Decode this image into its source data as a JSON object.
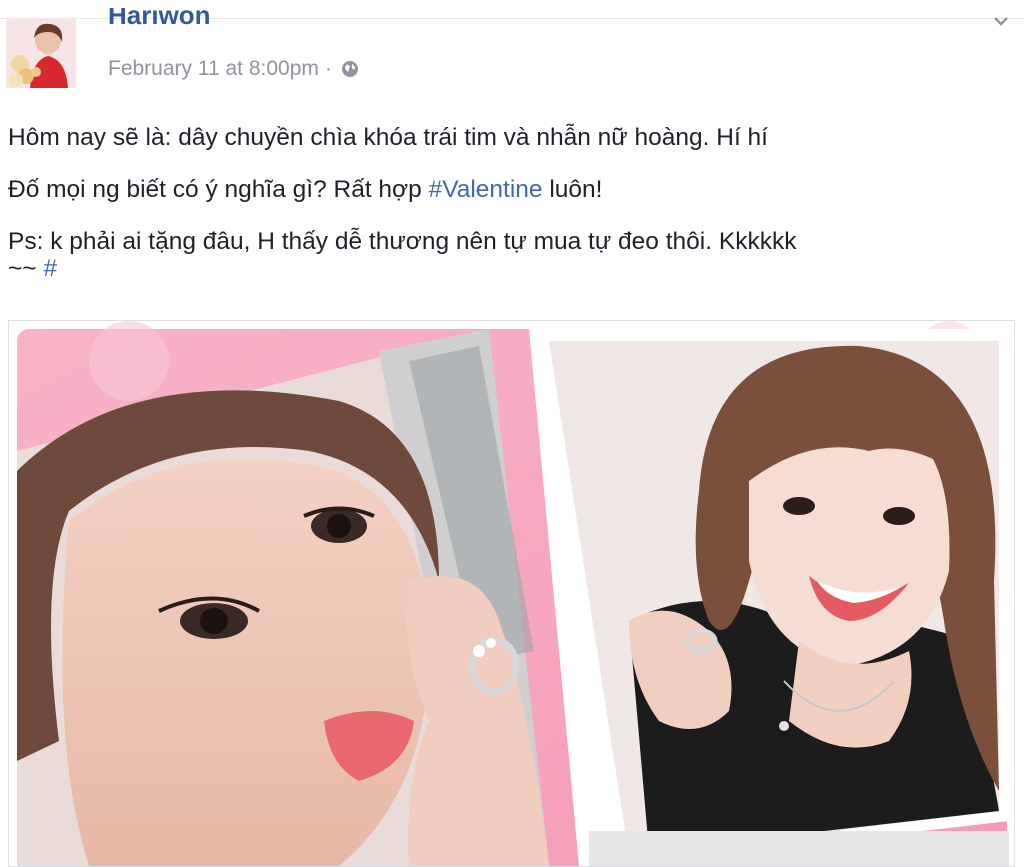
{
  "post": {
    "author": "Hariwon",
    "timestamp": "February 11 at 8:00pm",
    "separator": "·",
    "privacy_icon": "globe-icon",
    "menu_icon": "chevron-down-icon",
    "lines": [
      "Hôm nay sẽ là: dây chuyền chìa khóa trái tim và nhẫn nữ hoàng. Hí hí",
      {
        "before": "Đố mọi ng biết có ý nghĩa gì? Rất hợp ",
        "hashtag": "#Valentine",
        "after": " luôn!"
      },
      "Ps: k phải ai tặng đâu, H thấy dễ thương nên tự mua tự đeo thôi. Kkkkkk",
      {
        "before": "~~ ",
        "hashtag": "#"
      }
    ]
  },
  "colors": {
    "link": "#365899",
    "hashtag": "#4267b2",
    "meta": "#90949c",
    "text": "#1d2129",
    "pink_frame": "#f4a7c0"
  }
}
